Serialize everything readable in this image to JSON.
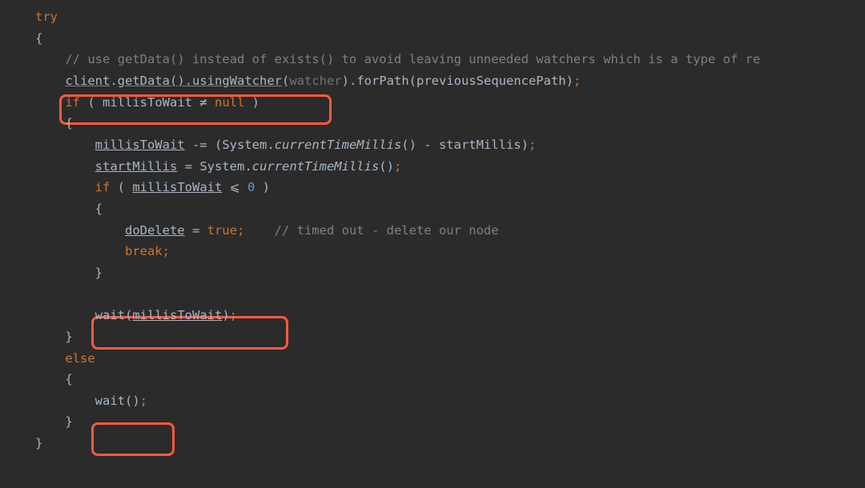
{
  "code": {
    "line1": {
      "try": "try"
    },
    "line2": {
      "brace": "{"
    },
    "line3": {
      "comment": "// use getData() instead of exists() to avoid leaving unneeded watchers which is a type of re"
    },
    "line4": {
      "client": "client",
      "getData": "getData",
      "usingWatcher": "usingWatcher",
      "watcher": "watcher",
      "forPath": "forPath",
      "previousSequencePath": "previousSequencePath"
    },
    "line5": {
      "if": "if",
      "millisToWait": "millisToWait",
      "neq": "≠",
      "null": "null"
    },
    "line6": {
      "brace": "{"
    },
    "line7": {
      "millisToWait": "millisToWait",
      "System": "System",
      "currentTimeMillis": "currentTimeMillis",
      "startMillis": "startMillis"
    },
    "line8": {
      "startMillis": "startMillis",
      "System": "System",
      "currentTimeMillis": "currentTimeMillis"
    },
    "line9": {
      "if": "if",
      "millisToWait": "millisToWait",
      "lte": "⩽",
      "zero": "0"
    },
    "line10": {
      "brace": "{"
    },
    "line11": {
      "doDelete": "doDelete",
      "true": "true",
      "comment": "// timed out - delete our node"
    },
    "line12": {
      "break": "break"
    },
    "line13": {
      "brace": "}"
    },
    "line14": {
      "empty": " "
    },
    "line15": {
      "wait": "wait",
      "millisToWait": "millisToWait"
    },
    "line16": {
      "brace": "}"
    },
    "line17": {
      "else": "else"
    },
    "line18": {
      "brace": "{"
    },
    "line19": {
      "wait": "wait"
    },
    "line20": {
      "brace": "}"
    },
    "line21": {
      "brace": "}"
    }
  },
  "highlights": {
    "box1": "if-millisToWait-not-null",
    "box2": "wait-millisToWait",
    "box3": "wait-empty"
  }
}
